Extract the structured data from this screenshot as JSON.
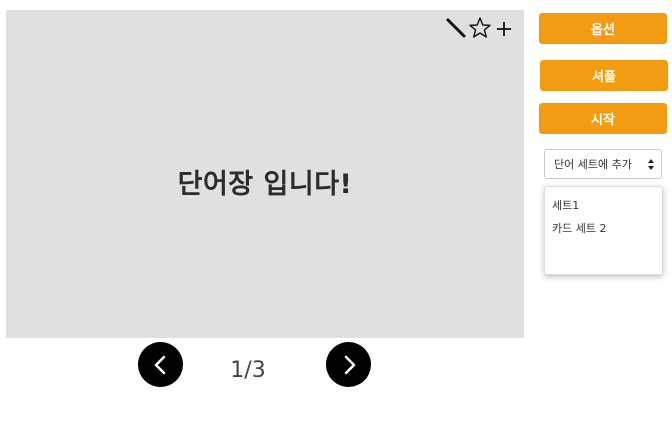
{
  "card": {
    "title": "단어장 입니다!",
    "tools": [
      "pencil-icon",
      "star-icon",
      "plus-icon"
    ]
  },
  "buttons": {
    "options": "옵션",
    "shuffle": "셔플",
    "start": "시작"
  },
  "set_select": {
    "selected": "단어 세트에 추가"
  },
  "set_dropdown": {
    "items": [
      "세트1",
      "카드 세트 2"
    ]
  },
  "pagination": {
    "counter": "1/3",
    "current": 1,
    "total": 3
  },
  "colors": {
    "accent": "#f39c12",
    "card_bg": "#e0e0e0",
    "nav_bg": "#000000"
  }
}
